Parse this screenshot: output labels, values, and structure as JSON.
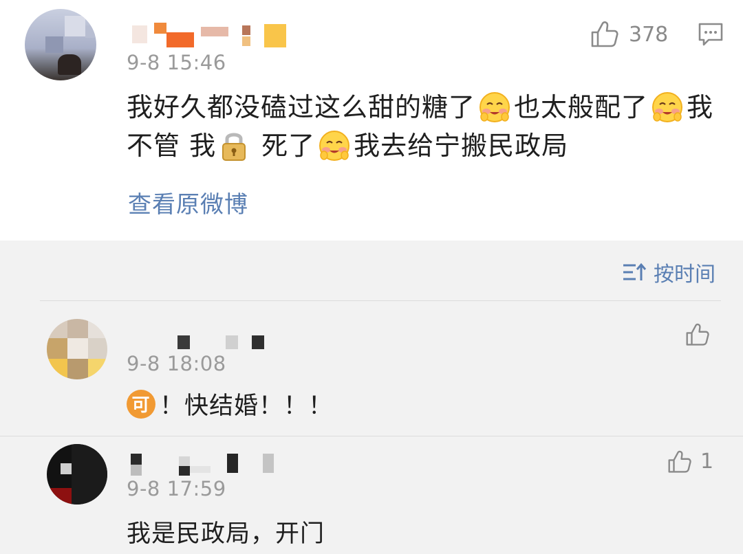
{
  "post": {
    "time": "9-8 15:46",
    "likes": "378",
    "text_line1_a": "我好久都没磕过这么甜的糖了",
    "text_line1_b": "也太般配了",
    "text_line1_c": "我",
    "text_line2_a": "不管 我",
    "text_line2_b": "死了",
    "text_line2_c": "我去给宁搬民政局",
    "view_original": "查看原微博",
    "icons": {
      "like": "thumbs-up-icon",
      "more": "comment-icon",
      "emoji": "blushing-face-emoji",
      "lock": "lock-emoji"
    }
  },
  "sort": {
    "label": "按时间",
    "icon": "sort-icon"
  },
  "comments": [
    {
      "time": "9-8 18:08",
      "badge": "可",
      "text": "！快结婚！！！",
      "likes": ""
    },
    {
      "time": "9-8 17:59",
      "text": "我是民政局，开门",
      "likes": "1"
    }
  ],
  "colors": {
    "link": "#5a7fb3",
    "badge": "#f19a33",
    "meta_gray": "#9a9a9a",
    "background": "#f2f2f2"
  }
}
